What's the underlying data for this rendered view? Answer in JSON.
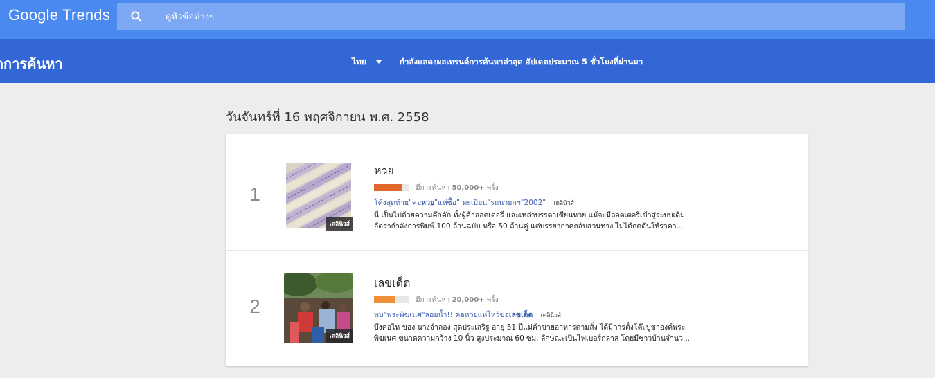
{
  "header": {
    "logo": "Google Trends",
    "search_placeholder": "ดูหัวข้อต่างๆ"
  },
  "subheader": {
    "title": "ดการค้นหา",
    "region": "ไทย",
    "status": "กำลังแสดงผลเทรนด์การค้นหาล่าสุด อัปเดตประมาณ 5 ชั่วโมงที่ผ่านมา"
  },
  "date_heading": "วันจันทร์ที่ 16 พฤศจิกายน พ.ศ. 2558",
  "trends": [
    {
      "rank": "1",
      "topic": "หวย",
      "volume_prefix": "มีการค้นหา",
      "volume_value": "50,000+",
      "volume_suffix": "ครั้ง",
      "volume_fraction": 0.8,
      "volume_color": "#e0662a",
      "headline_parts": [
        "โค้งสุดท้าย\"คอ",
        "หวย",
        "\"แห่ซื้อ\" ทะเบียน\"รถนายกฯ\"2002\""
      ],
      "source": "เดลินิวส์",
      "snippet_1": "นี่ เป็นไปด้วยความคึกคัก ทั้งผู้ค้าลอตเตอรี่ และเหล่าบรรดาเซียนหวย แม้จะมีลอตเตอรี่เข้าสู่ระบบเดิม",
      "snippet_2": "อัตรากำลังการพิมพ์ 100 ล้านฉบับ หรือ 50 ล้านคู่ แต่บรรยากาศกลับสวนทาง ไม่ได้กดดันให้ราคา...",
      "thumb_label": "เดลินิวส์"
    },
    {
      "rank": "2",
      "topic": "เลขเด็ด",
      "volume_prefix": "มีการค้นหา",
      "volume_value": "20,000+",
      "volume_suffix": "ครั้ง",
      "volume_fraction": 0.6,
      "volume_color": "#f0913a",
      "headline_parts": [
        "พบ\"พระพิฆเนศ\"ลอยน้ำ!! คอหวยแห่ไหว้ขอ",
        "เลขเด็ด",
        ""
      ],
      "source": "เดลินิวส์",
      "snippet_1": "บึงคอไห ของ นางจำลอง สุดประเสริฐ อายุ 51 ปีแม่ค้าขายอาหารตามสั่ง ได้มีการตั้งโต๊ะบูชาองค์พระ",
      "snippet_2": "พิฆเนศ ขนาดความกว้าง 10 นิ้ว สูงประมาณ 60 ซม. ลักษณะเป็นไฟเบอร์กลาส โดยมีชาวบ้านจำนว...",
      "thumb_label": "เดลินิวส์"
    }
  ]
}
